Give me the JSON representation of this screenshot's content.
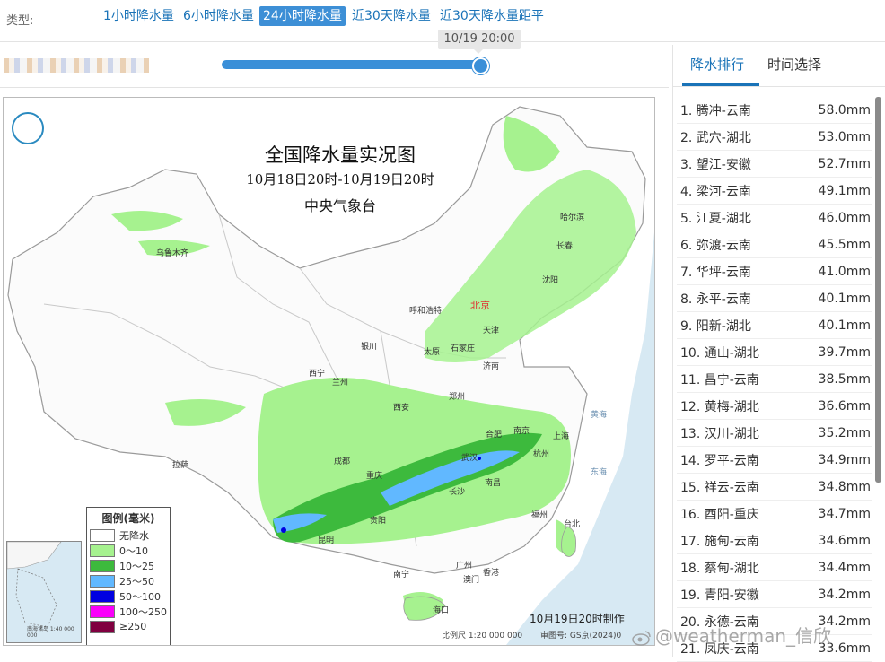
{
  "filter": {
    "type_label": "类型:",
    "tabs": [
      {
        "label": "1小时降水量",
        "active": false
      },
      {
        "label": "6小时降水量",
        "active": false
      },
      {
        "label": "24小时降水量",
        "active": true
      },
      {
        "label": "近30天降水量",
        "active": false
      },
      {
        "label": "近30天降水量距平",
        "active": false
      }
    ]
  },
  "timeline": {
    "current_time": "10/19 20:00",
    "progress": 1.0
  },
  "map": {
    "title": "全国降水量实况图",
    "subtitle": "10月18日20时-10月19日20时",
    "org": "中央气象台",
    "made_label": "10月19日20时制作",
    "scale_label": "比例尺 1:20 000 000",
    "review_label": "审图号: GS京(2024)0",
    "cities": {
      "wulumuqi": "乌鲁木齐",
      "haerbin": "哈尔滨",
      "changchun": "长春",
      "shenyang": "沈阳",
      "huhehaote": "呼和浩特",
      "beijing": "北京",
      "tianjin": "天津",
      "yinchuan": "银川",
      "taiyuan": "太原",
      "shijiazhuang": "石家庄",
      "xining": "西宁",
      "lanzhou": "兰州",
      "jinan": "济南",
      "zhengzhou": "郑州",
      "xian": "西安",
      "hefei": "合肥",
      "nanjing": "南京",
      "shanghai": "上海",
      "lasa": "拉萨",
      "chengdu": "成都",
      "wuhan": "武汉",
      "hangzhou": "杭州",
      "chongqing": "重庆",
      "changsha": "长沙",
      "nanchang": "南昌",
      "guiyang": "贵阳",
      "fuzhou": "福州",
      "kunming": "昆明",
      "taibei": "台北",
      "nanning": "南宁",
      "guangzhou": "广州",
      "xianggang": "香港",
      "aomen": "澳门",
      "haikou": "海口"
    },
    "seas": {
      "huanghai": "黄海",
      "donghai": "东海"
    },
    "legend": {
      "title": "图例(毫米)",
      "items": [
        {
          "label": "无降水",
          "color": "#ffffff"
        },
        {
          "label": "0～10",
          "color": "#a6f28f"
        },
        {
          "label": "10～25",
          "color": "#3dba3d"
        },
        {
          "label": "25～50",
          "color": "#61b8ff"
        },
        {
          "label": "50～100",
          "color": "#0000e1"
        },
        {
          "label": "100～250",
          "color": "#fa00fa"
        },
        {
          "label": "≥250",
          "color": "#800040"
        }
      ]
    },
    "inset_label": "南海诸岛\n1:40 000 000"
  },
  "ranking": {
    "tabs": [
      {
        "label": "降水排行",
        "active": true
      },
      {
        "label": "时间选择",
        "active": false
      }
    ],
    "rows": [
      {
        "label": "1. 腾冲-云南",
        "value": "58.0mm"
      },
      {
        "label": "2. 武穴-湖北",
        "value": "53.0mm"
      },
      {
        "label": "3. 望江-安徽",
        "value": "52.7mm"
      },
      {
        "label": "4. 梁河-云南",
        "value": "49.1mm"
      },
      {
        "label": "5. 江夏-湖北",
        "value": "46.0mm"
      },
      {
        "label": "6. 弥渡-云南",
        "value": "45.5mm"
      },
      {
        "label": "7. 华坪-云南",
        "value": "41.0mm"
      },
      {
        "label": "8. 永平-云南",
        "value": "40.1mm"
      },
      {
        "label": "9. 阳新-湖北",
        "value": "40.1mm"
      },
      {
        "label": "10. 通山-湖北",
        "value": "39.7mm"
      },
      {
        "label": "11. 昌宁-云南",
        "value": "38.5mm"
      },
      {
        "label": "12. 黄梅-湖北",
        "value": "36.6mm"
      },
      {
        "label": "13. 汉川-湖北",
        "value": "35.2mm"
      },
      {
        "label": "14. 罗平-云南",
        "value": "34.9mm"
      },
      {
        "label": "15. 祥云-云南",
        "value": "34.8mm"
      },
      {
        "label": "16. 酉阳-重庆",
        "value": "34.7mm"
      },
      {
        "label": "17. 施甸-云南",
        "value": "34.6mm"
      },
      {
        "label": "18. 蔡甸-湖北",
        "value": "34.4mm"
      },
      {
        "label": "19. 青阳-安徽",
        "value": "34.2mm"
      },
      {
        "label": "20. 永德-云南",
        "value": "34.2mm"
      },
      {
        "label": "21. 凤庆-云南",
        "value": "33.6mm"
      }
    ]
  },
  "watermark": "@weatherman_信欣"
}
